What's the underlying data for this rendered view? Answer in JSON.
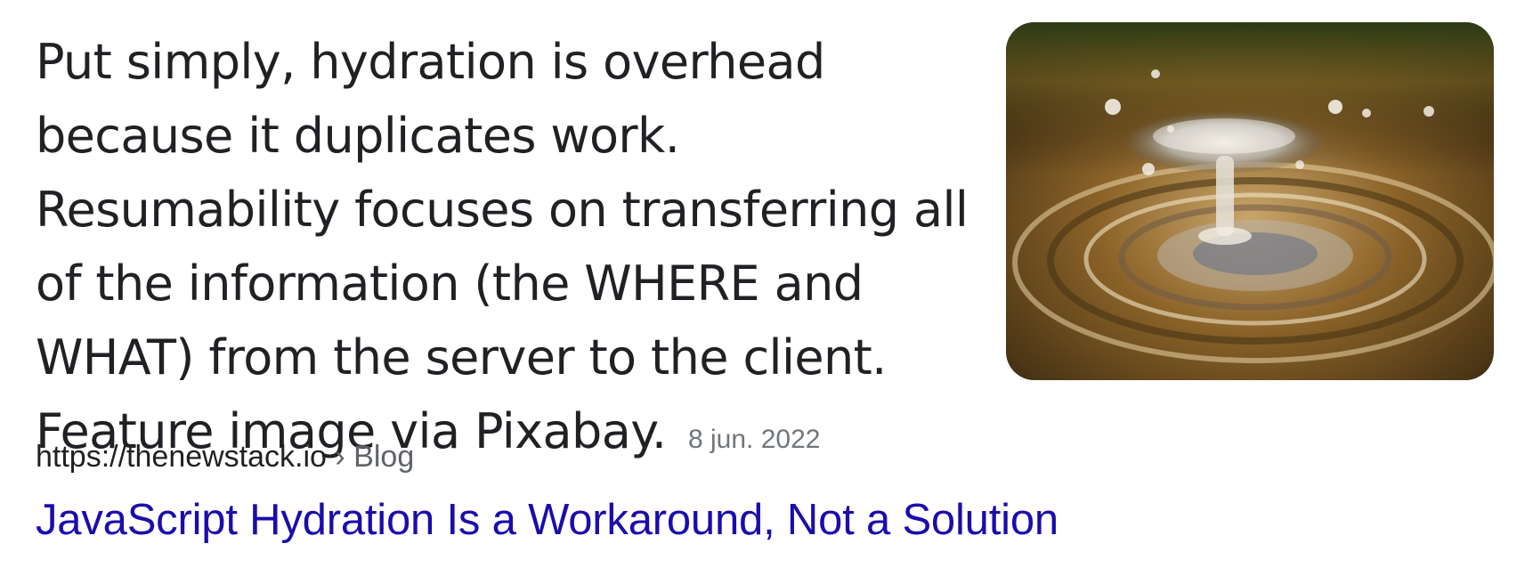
{
  "snippet": {
    "text": "Put simply, hydration is overhead because it duplicates work. Resumability focuses on transferring all of the information (the WHERE and WHAT) from the server to the client. Feature image via Pixabay.",
    "date": "8 jun. 2022"
  },
  "thumbnail": {
    "description": "water-drop-splash-image"
  },
  "result": {
    "url": "https://thenewstack.io",
    "separator": " › ",
    "breadcrumb": "Blog",
    "title": "JavaScript Hydration Is a Workaround, Not a Solution"
  },
  "colors": {
    "title_link": "#1a0dab",
    "body_text": "#202124",
    "muted_text": "#70757a"
  }
}
